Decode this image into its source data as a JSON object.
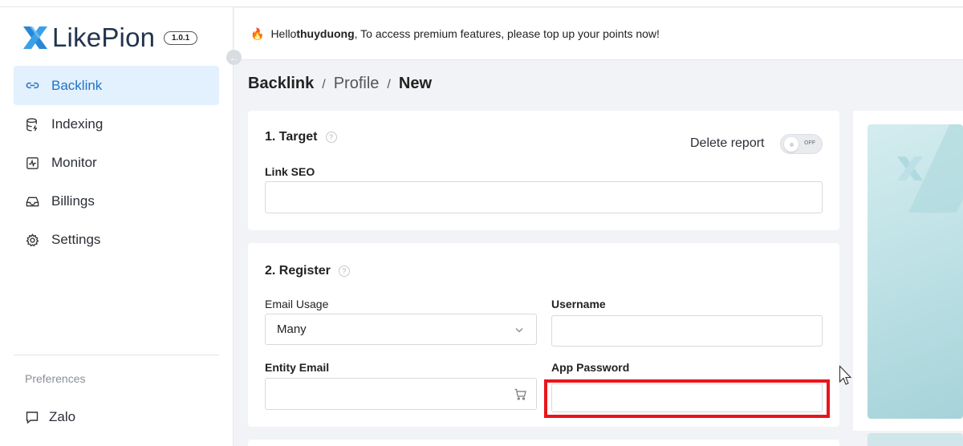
{
  "app": {
    "name": "LikePion",
    "version": "1.0.1"
  },
  "sidebar": {
    "items": [
      {
        "label": "Backlink",
        "icon": "link-icon",
        "active": true
      },
      {
        "label": "Indexing",
        "icon": "database-icon",
        "active": false
      },
      {
        "label": "Monitor",
        "icon": "monitor-icon",
        "active": false
      },
      {
        "label": "Billings",
        "icon": "inbox-icon",
        "active": false
      },
      {
        "label": "Settings",
        "icon": "gear-icon",
        "active": false
      }
    ],
    "preferences_label": "Preferences",
    "zalo_label": "Zalo"
  },
  "header": {
    "hello": "Hello ",
    "username": "thuyduong",
    "message": ", To access premium features, please top up your points now!"
  },
  "breadcrumb": {
    "part1": "Backlink",
    "part2": "Profile",
    "part3": "New",
    "separator": "/"
  },
  "target": {
    "title": "1. Target",
    "delete_report_label": "Delete report",
    "toggle_state": "OFF",
    "link_seo_label": "Link SEO",
    "link_seo_value": ""
  },
  "register": {
    "title": "2. Register",
    "email_usage_label": "Email Usage",
    "email_usage_value": "Many",
    "username_label": "Username",
    "username_value": "",
    "entity_email_label": "Entity Email",
    "entity_email_value": "",
    "app_password_label": "App Password",
    "app_password_value": ""
  },
  "colors": {
    "accent": "#1e73c8",
    "active_bg": "#e3f0fd",
    "highlight": "#e8151b",
    "logo": "#22344d"
  }
}
